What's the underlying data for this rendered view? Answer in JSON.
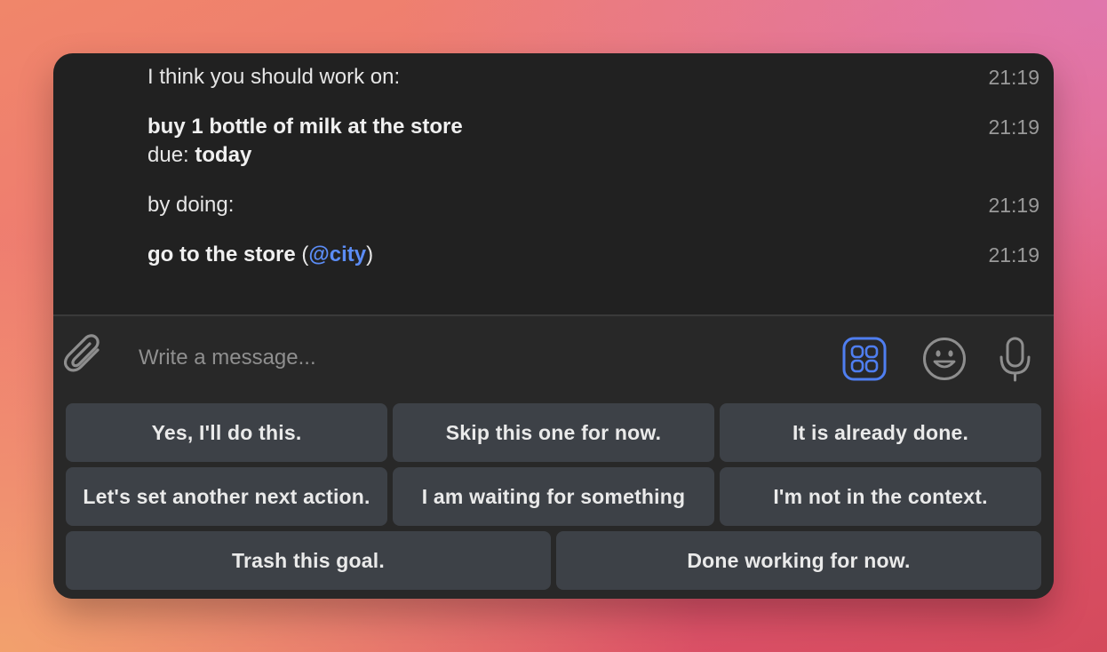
{
  "messages": [
    {
      "text": "I think you should work on:",
      "time": "21:19"
    },
    {
      "title": "buy 1 bottle of milk at the store",
      "due_label": "due: ",
      "due_value": "today",
      "time": "21:19"
    },
    {
      "text": "by doing:",
      "time": "21:19"
    },
    {
      "action": "go to the store",
      "open": " (",
      "mention": "@city",
      "close": ")",
      "time": "21:19"
    }
  ],
  "composer": {
    "placeholder": "Write a message..."
  },
  "icons": {
    "attach": "paperclip-icon",
    "commands": "bot-commands-icon",
    "emoji": "emoji-icon",
    "voice": "microphone-icon"
  },
  "colors": {
    "accent": "#4f7ef0",
    "mention": "#5b8cf5",
    "button_bg": "#3d4147",
    "panel_bg": "#212121"
  },
  "keyboard": {
    "rows": [
      [
        "Yes, I'll do this.",
        "Skip this one for now.",
        "It is already done."
      ],
      [
        "Let's set another next action.",
        "I am waiting for something",
        "I'm not in the context."
      ],
      [
        "Trash this goal.",
        "Done working for now."
      ]
    ]
  }
}
